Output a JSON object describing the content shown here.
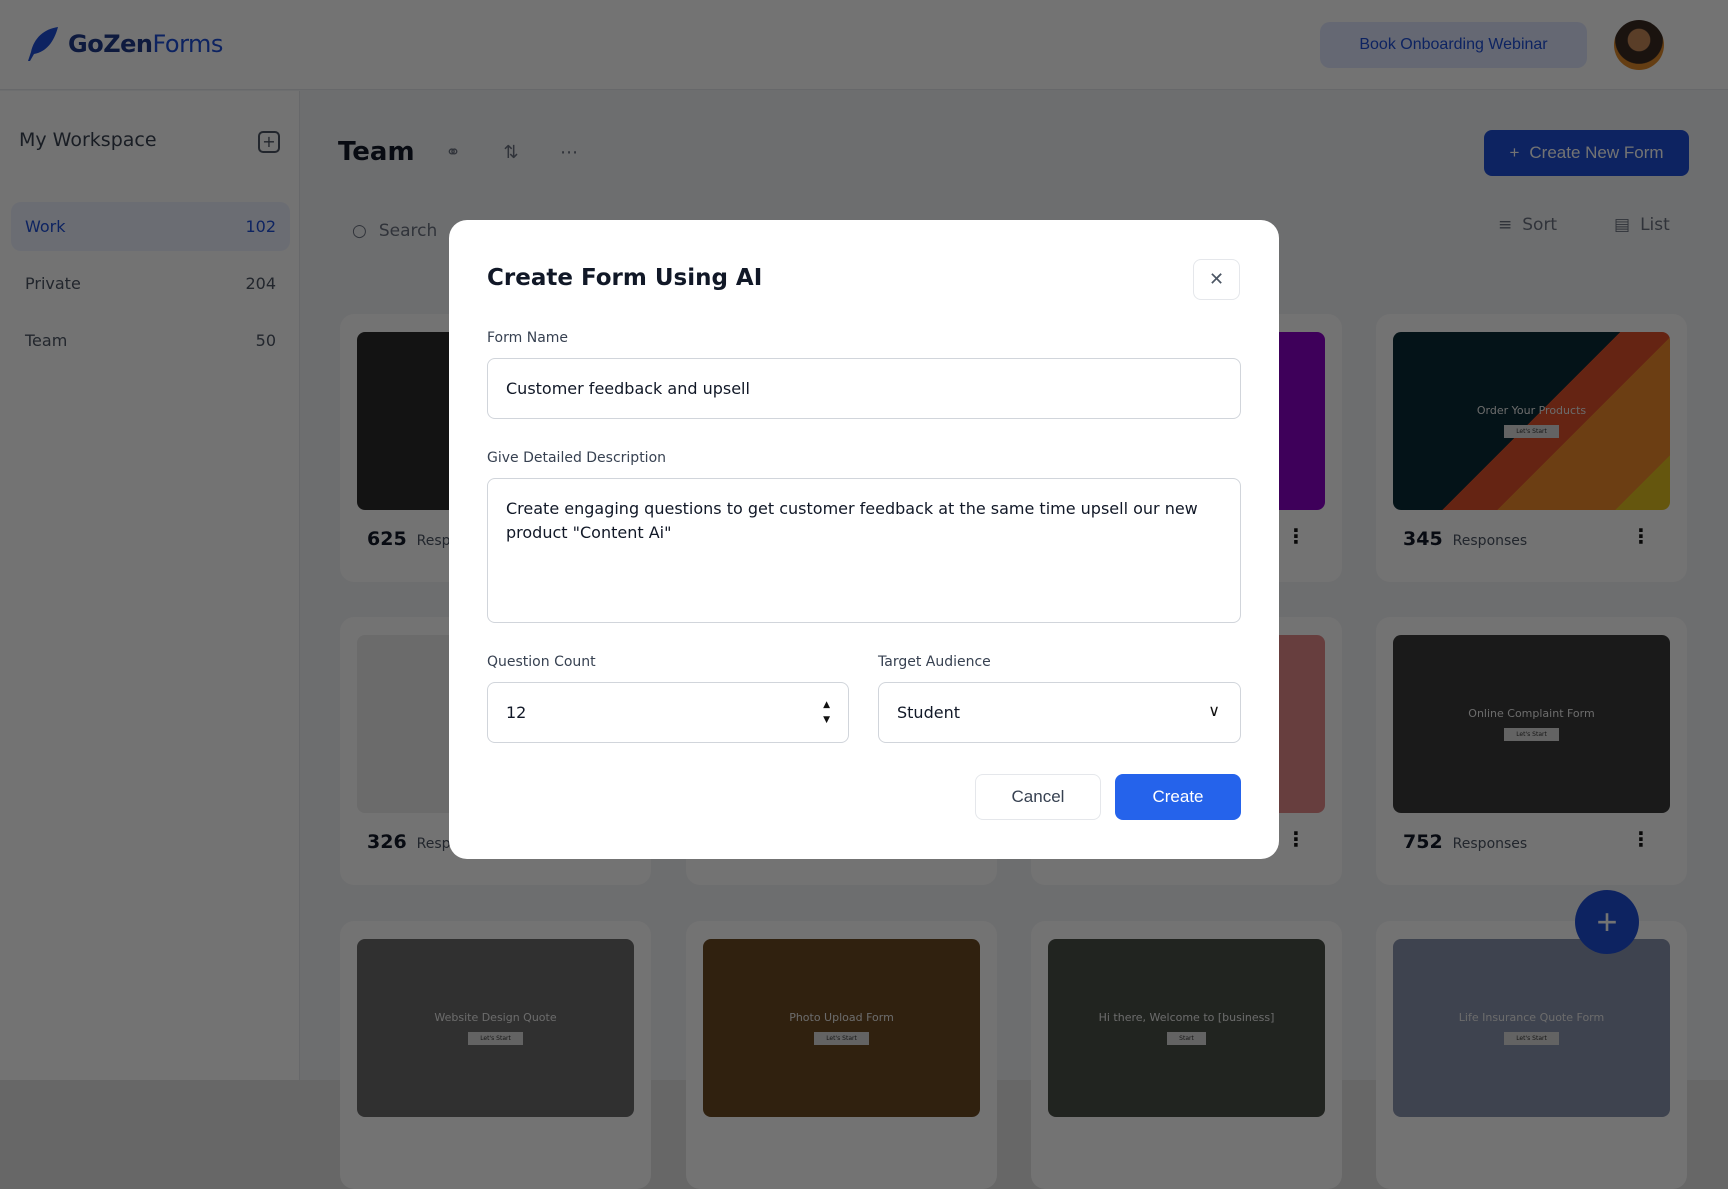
{
  "header": {
    "logo_bold": "GoZen",
    "logo_light": "Forms",
    "webinar_button": "Book Onboarding Webinar"
  },
  "sidebar": {
    "title": "My Workspace",
    "items": [
      {
        "label": "Work",
        "count": "102",
        "active": true
      },
      {
        "label": "Private",
        "count": "204"
      },
      {
        "label": "Team",
        "count": "50"
      }
    ]
  },
  "main": {
    "title": "Team",
    "create_button": "Create New Form",
    "search_placeholder": "Search",
    "sort_label": "Sort",
    "view_label": "List",
    "cards": [
      {
        "thumb": "",
        "count": "625",
        "label": "Responses",
        "bg": "#2b2b2b"
      },
      {
        "thumb": "",
        "count": "",
        "label": "",
        "bg": "#5b2b8a"
      },
      {
        "thumb": "",
        "count": "",
        "label": "",
        "bg": "#8a00c8"
      },
      {
        "thumb": "Order Your Products",
        "button": "Let's Start",
        "count": "345",
        "label": "Responses",
        "bg": "linear-gradient(135deg,#0a2a35 50%,#e0502a 50% 62%,#f08a2a 62% 88%,#e0c020 88%)"
      },
      {
        "thumb": "",
        "count": "326",
        "label": "Responses",
        "bg": "#eeeeee"
      },
      {
        "thumb": "",
        "count": "",
        "label": "",
        "bg": "#c0c0c0"
      },
      {
        "thumb": "",
        "count": "",
        "label": "",
        "bg": "#e58a8a"
      },
      {
        "thumb": "Online Complaint Form",
        "button": "Let's Start",
        "count": "752",
        "label": "Responses",
        "bg": "#3a3a3a"
      },
      {
        "thumb": "Website Design Quote",
        "button": "Let's Start",
        "bg": "#6a6a6a"
      },
      {
        "thumb": "Photo Upload Form",
        "button": "Let's Start",
        "bg": "#6b4a22"
      },
      {
        "thumb": "Hi there, Welcome to [business]",
        "button": "Start",
        "bg": "#4a5048"
      },
      {
        "thumb": "Life Insurance Quote Form",
        "button": "Let's Start",
        "bg": "#8a94b0"
      }
    ]
  },
  "modal": {
    "title": "Create Form Using AI",
    "form_name_label": "Form Name",
    "form_name_value": "Customer feedback and upsell",
    "description_label": "Give Detailed Description",
    "description_value": "Create engaging questions to get customer feedback at the same time upsell our new product \"Content Ai\"",
    "question_count_label": "Question Count",
    "question_count_value": "12",
    "audience_label": "Target Audience",
    "audience_value": "Student",
    "cancel": "Cancel",
    "create": "Create"
  },
  "colors": {
    "accent": "#1d4ed8",
    "primary_button": "#2563eb"
  }
}
